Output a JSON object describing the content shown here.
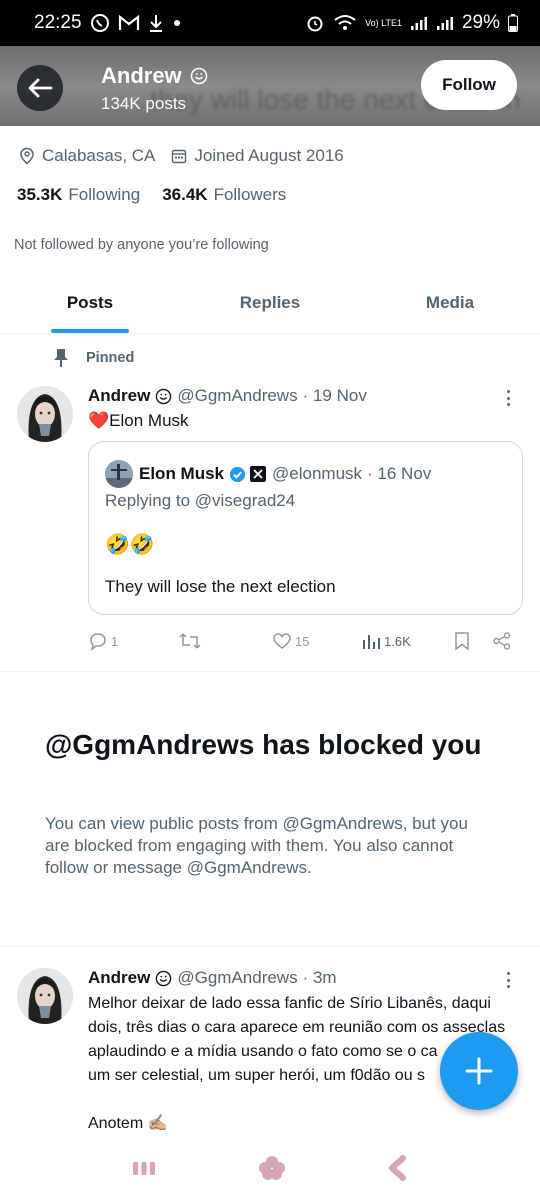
{
  "status_bar": {
    "time": "22:25",
    "battery": "29%",
    "volte": "Vo) LTE1"
  },
  "header": {
    "name": "Andrew",
    "posts_count": "134K posts",
    "follow_label": "Follow",
    "ghost_text": "they will lose the next election"
  },
  "profile": {
    "location": "Calabasas, CA",
    "joined": "Joined August 2016",
    "following_count": "35.3K",
    "following_label": "Following",
    "followers_count": "36.4K",
    "followers_label": "Followers",
    "not_followed": "Not followed by anyone you’re following"
  },
  "tabs": [
    {
      "label": "Posts",
      "active": true
    },
    {
      "label": "Replies",
      "active": false
    },
    {
      "label": "Media",
      "active": false
    }
  ],
  "pinned_label": "Pinned",
  "tweet1": {
    "name": "Andrew",
    "handle": "@GgmAndrews",
    "time": "· 19 Nov",
    "text": "Elon Musk",
    "heart_emoji": "❤️",
    "quote": {
      "name": "Elon Musk",
      "handle": "@elonmusk",
      "time": "· 16 Nov",
      "replying": "Replying to @visegrad24",
      "emoji": "🤣🤣",
      "text": "They will lose the next election"
    },
    "actions": {
      "replies": "1",
      "retweets": "",
      "likes": "15",
      "views": "1.6K"
    }
  },
  "blocked": {
    "title": "@GgmAndrews has blocked you",
    "description": "You can view public posts from @GgmAndrews, but you are blocked from engaging with them. You also cannot follow or message @GgmAndrews."
  },
  "tweet2": {
    "name": "Andrew",
    "handle": "@GgmAndrews",
    "time": "· 3m",
    "lines": [
      "Melhor deixar de lado essa fanfic de Sírio Libanês, daqui",
      "dois, três dias o cara aparece em reunião com os asseclas",
      "aplaudindo e a mídia usando o fato como se o ca",
      "um ser celestial, um super herói, um f0dão ou s"
    ],
    "last_line": "Anotem ✍🏼"
  },
  "colors": {
    "accent": "#1d9bf0",
    "text": "#0f1419",
    "muted": "#536471"
  }
}
